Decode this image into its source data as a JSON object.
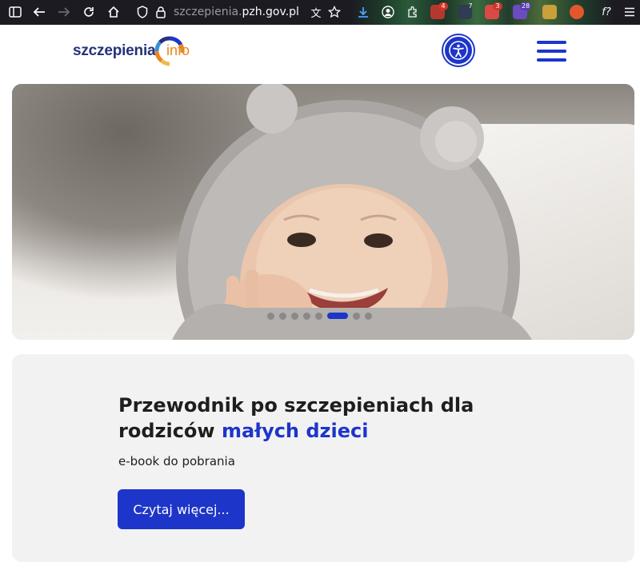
{
  "browser": {
    "url_prefix": "szczepienia.",
    "url_domain": "pzh.gov.pl",
    "badges": [
      "4",
      "7",
      "3",
      "28"
    ],
    "extension_glyph": "f?"
  },
  "header": {
    "logo_main": "szczepienia",
    "logo_sub": "info",
    "accessibility_label": "Accessibility",
    "menu_label": "Menu",
    "colors": {
      "primary": "#1d35c9",
      "logo_text": "#24327a",
      "logo_accent": "#e8861f"
    }
  },
  "hero": {
    "slides_count": 8,
    "active_slide": 5
  },
  "card": {
    "title_main": "Przewodnik po szczepieniach dla rodziców ",
    "title_accent": "małych dzieci",
    "subtitle": "e-book do pobrania",
    "cta_label": "Czytaj więcej..."
  }
}
